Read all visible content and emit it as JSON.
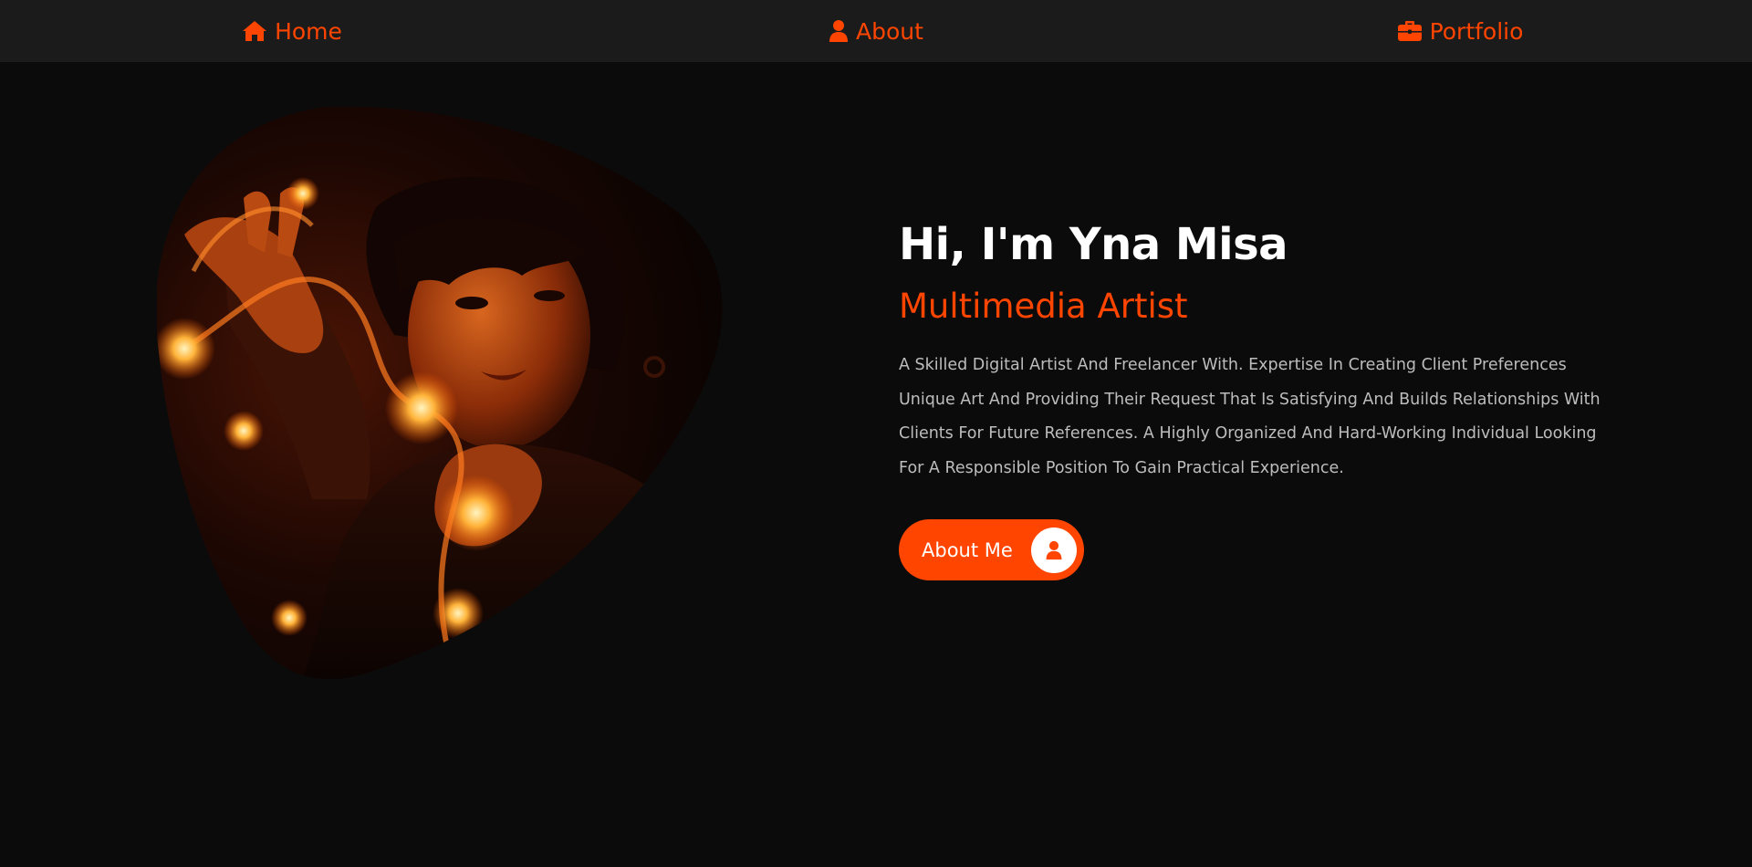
{
  "nav": {
    "items": [
      {
        "label": "Home",
        "icon": "home-icon"
      },
      {
        "label": "About",
        "icon": "user-icon"
      },
      {
        "label": "Portfolio",
        "icon": "briefcase-icon"
      }
    ]
  },
  "hero": {
    "greeting": "Hi, I'm Yna Misa",
    "role": "Multimedia Artist",
    "description": "A Skilled Digital Artist And Freelancer With. Expertise In Creating Client Preferences Unique Art And Providing Their Request That Is Satisfying And Builds Relationships With Clients For Future References. A Highly Organized And Hard-Working Individual Looking For A Responsible Position To Gain Practical Experience.",
    "cta_label": "About Me",
    "cta_icon": "user-icon",
    "image": "portrait-photo"
  },
  "colors": {
    "accent": "#ff4500",
    "background": "#0b0b0b",
    "navbar": "#1b1b1b",
    "heading": "#ffffff",
    "body_text": "#bdbdbd"
  }
}
